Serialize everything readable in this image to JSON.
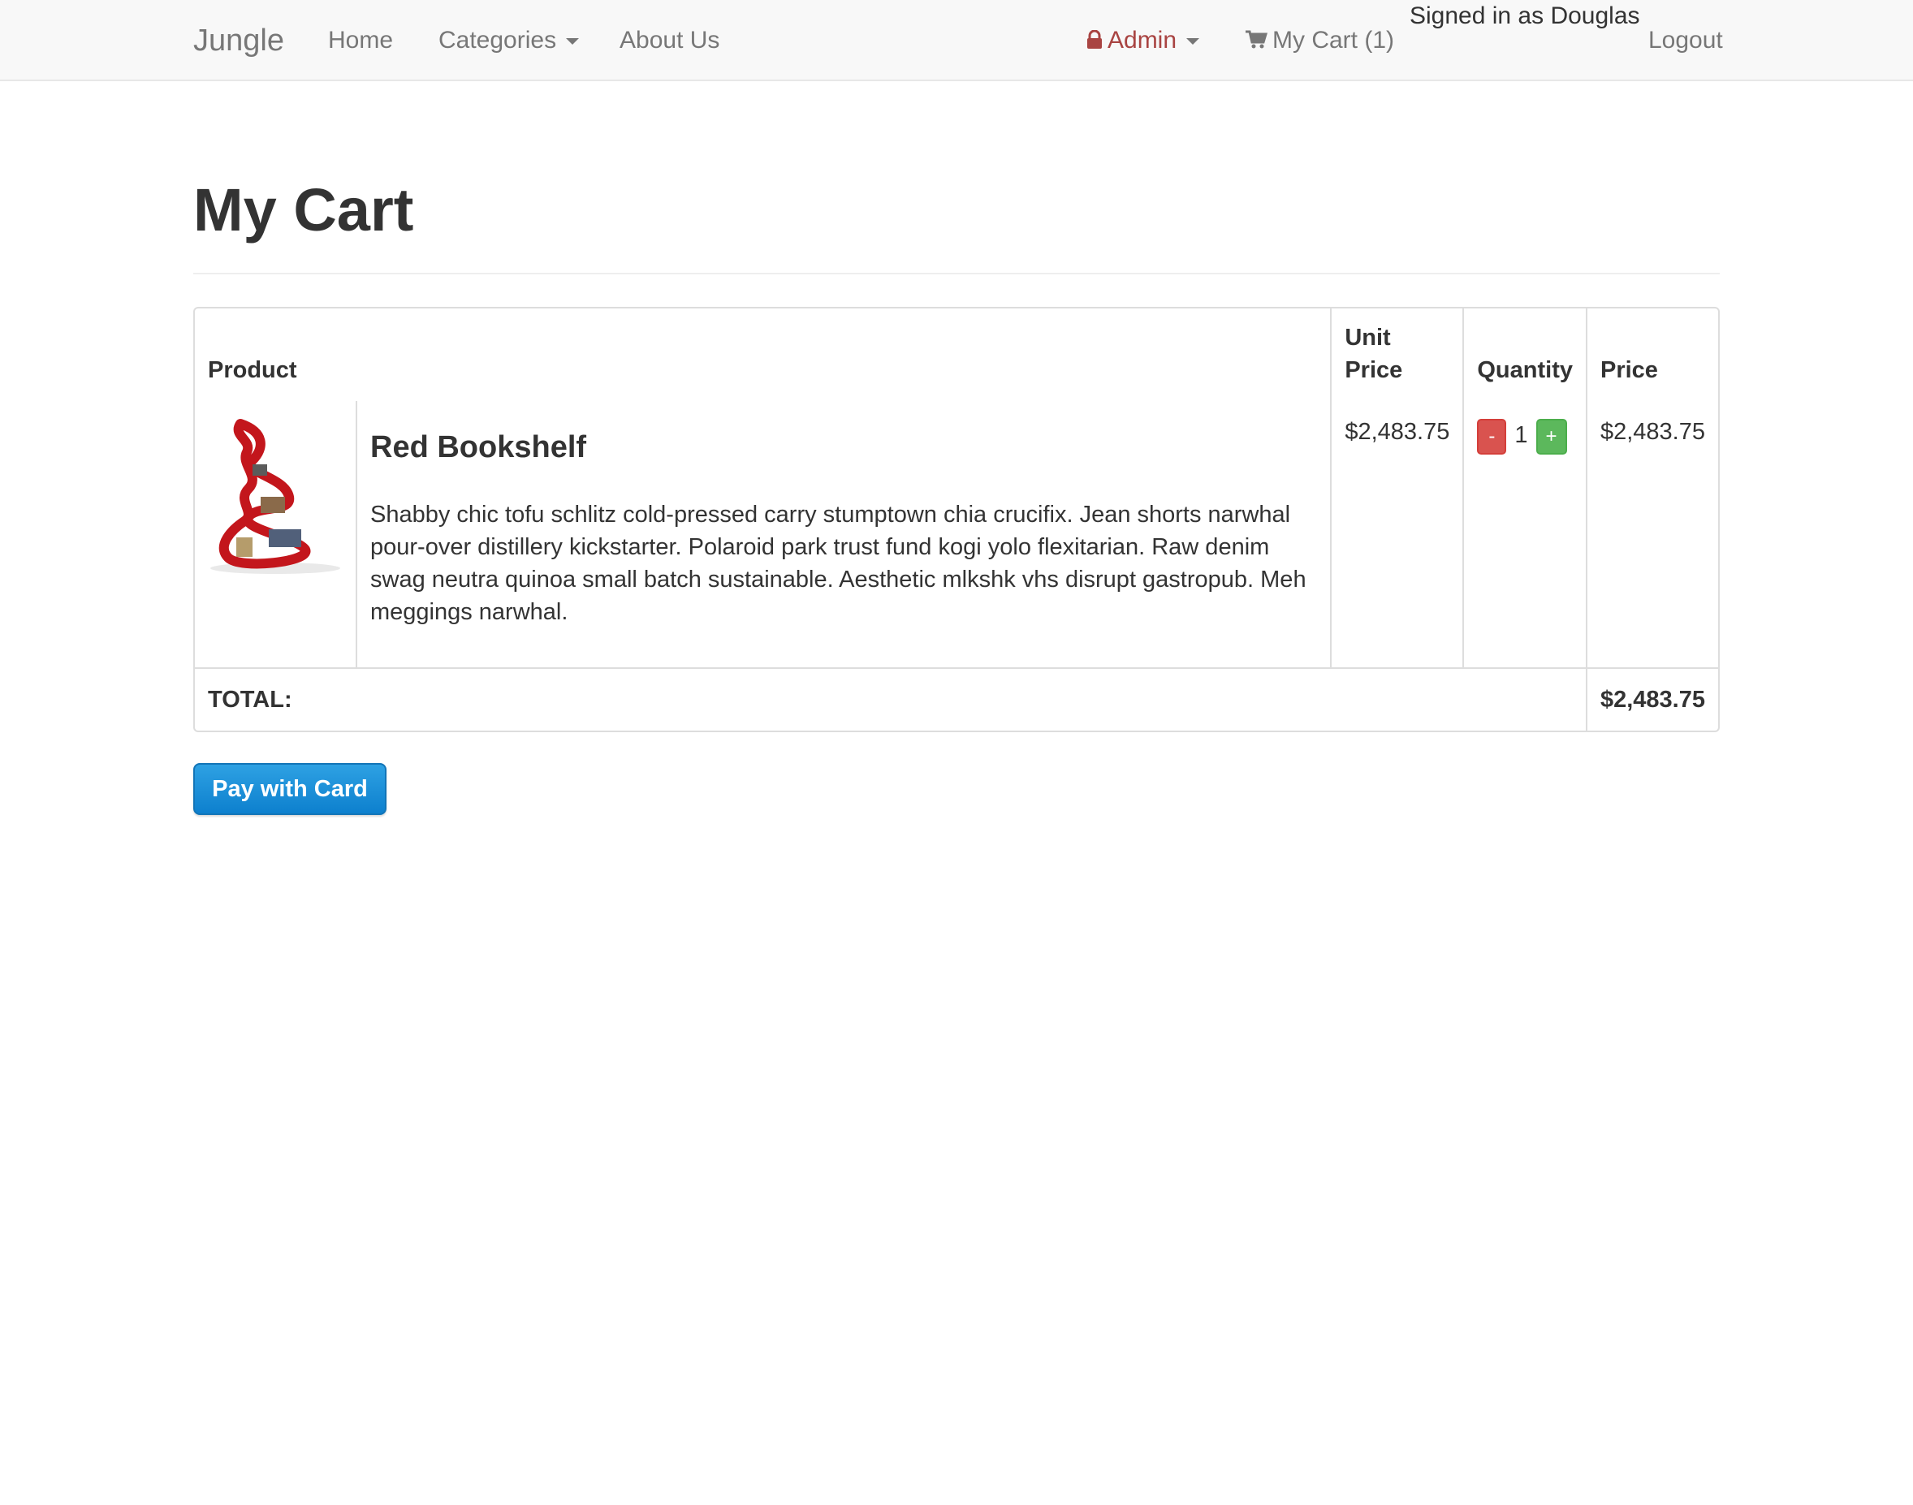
{
  "navbar": {
    "brand": "Jungle",
    "home": "Home",
    "categories": "Categories",
    "about": "About Us",
    "admin": "Admin",
    "cart": "My Cart (1)",
    "signed_in": "Signed in as Douglas",
    "logout": "Logout"
  },
  "page": {
    "title": "My Cart"
  },
  "table": {
    "headers": {
      "product": "Product",
      "unit_price_1": "Unit",
      "unit_price_2": "Price",
      "quantity": "Quantity",
      "price": "Price"
    },
    "items": [
      {
        "name": "Red Bookshelf",
        "description": "Shabby chic tofu schlitz cold-pressed carry stumptown chia crucifix. Jean shorts narwhal pour-over distillery kickstarter. Polaroid park trust fund kogi yolo flexitarian. Raw denim swag neutra quinoa small batch sustainable. Aesthetic mlkshk vhs disrupt gastropub. Meh meggings narwhal.",
        "unit_price": "$2,483.75",
        "quantity": "1",
        "minus": "-",
        "plus": "+",
        "price": "$2,483.75"
      }
    ],
    "total_label": "TOTAL:",
    "total_value": "$2,483.75"
  },
  "pay_button": "Pay with Card",
  "colors": {
    "admin": "#a94442",
    "pay_button": "#1b8fd8",
    "minus_button": "#d9534f",
    "plus_button": "#5cb85c"
  }
}
